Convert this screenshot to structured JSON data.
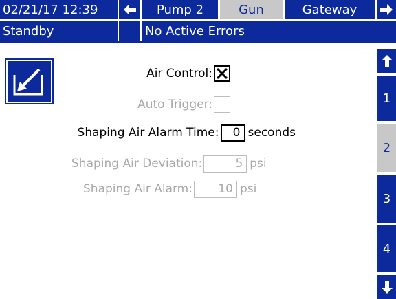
{
  "header": {
    "datetime": "02/21/17 12:39",
    "tabs": [
      "Pump 2",
      "Gun",
      "Gateway"
    ],
    "active_tab": "Gun"
  },
  "status": {
    "state": "Standby",
    "errors": "No Active Errors"
  },
  "form": {
    "air_control": {
      "label": "Air Control:",
      "checked": true,
      "mark": "✕"
    },
    "auto_trigger": {
      "label": "Auto Trigger:",
      "checked": false
    },
    "alarm_time": {
      "label": "Shaping Air Alarm Time:",
      "value": "0",
      "unit": "seconds"
    },
    "deviation": {
      "label": "Shaping Air Deviation:",
      "value": "5",
      "unit": "psi"
    },
    "alarm": {
      "label": "Shaping Air Alarm:",
      "value": "10",
      "unit": "psi"
    }
  },
  "side": {
    "pages": [
      "1",
      "2",
      "3",
      "4"
    ],
    "active_page": "2"
  },
  "colors": {
    "primary": "#0c2a9c",
    "active": "#c8c8c8",
    "disabled": "#a9a9a9"
  }
}
